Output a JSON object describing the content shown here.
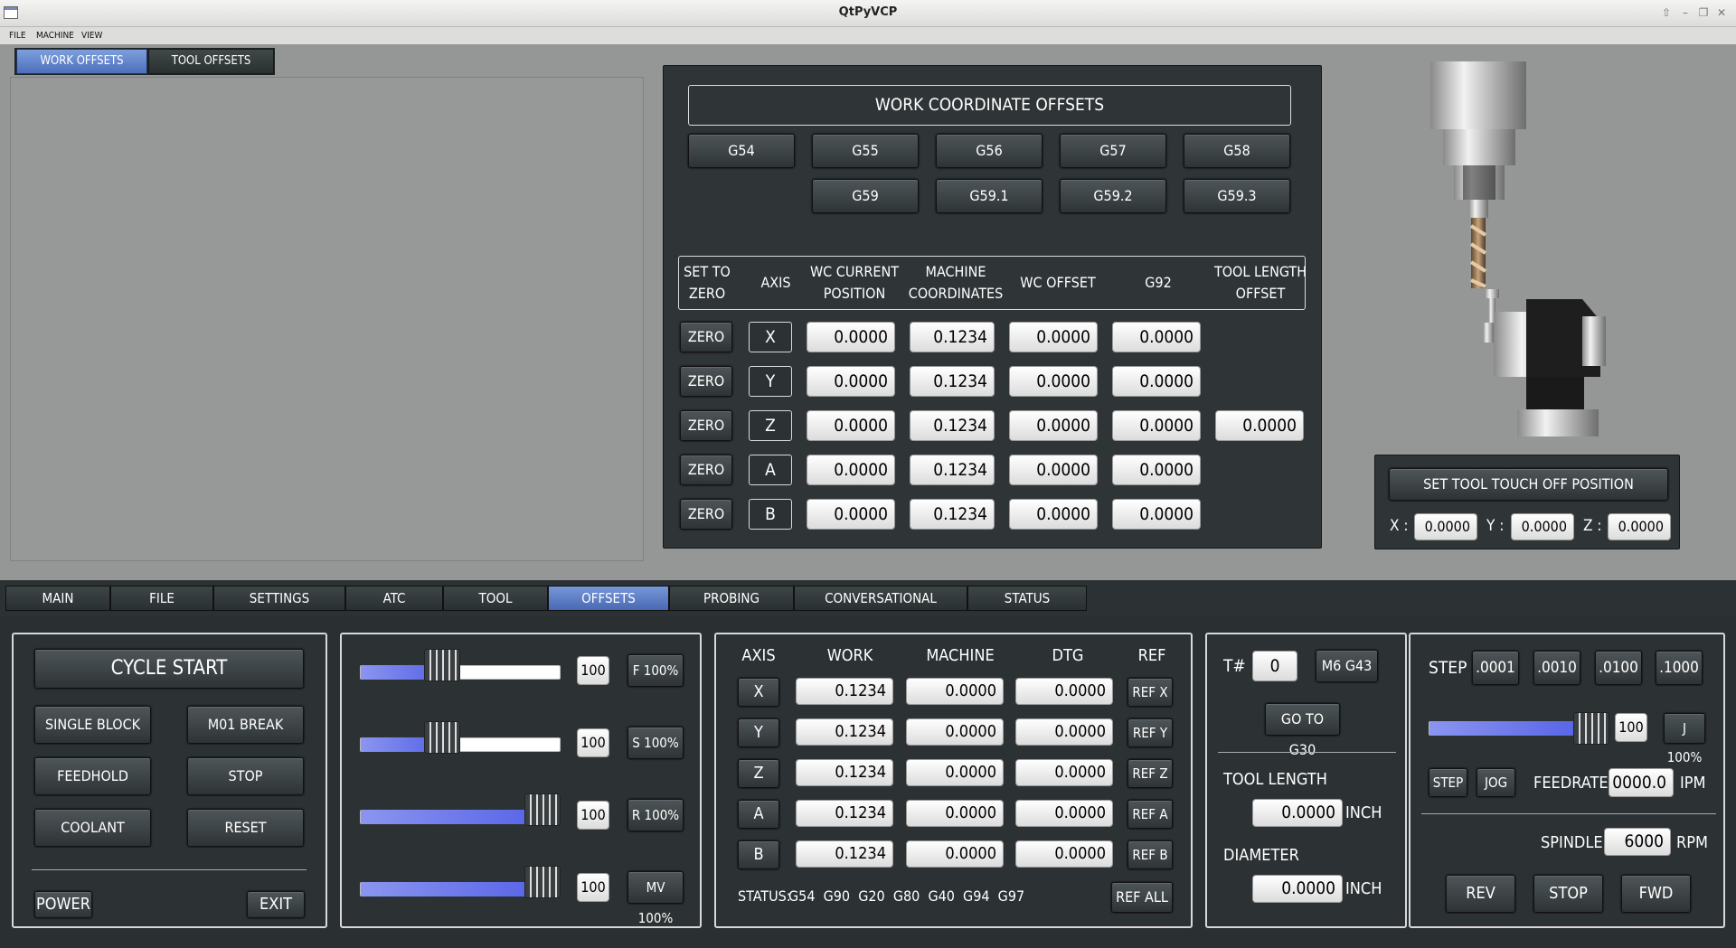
{
  "window": {
    "title": "QtPyVCP"
  },
  "menu": [
    "FILE",
    "MACHINE",
    "VIEW"
  ],
  "top_tabs": [
    {
      "label": "WORK OFFSETS",
      "active": true
    },
    {
      "label": "TOOL OFFSETS",
      "active": false
    }
  ],
  "wco": {
    "title": "WORK COORDINATE OFFSETS",
    "row1": [
      "G54",
      "G55",
      "G56",
      "G57",
      "G58"
    ],
    "row2": [
      "G59",
      "G59.1",
      "G59.2",
      "G59.3"
    ],
    "headers": [
      "SET TO ZERO",
      "AXIS",
      "WC CURRENT POSITION",
      "MACHINE COORDINATES",
      "WC OFFSET",
      "G92",
      "TOOL LENGTH OFFSET"
    ],
    "zero_label": "ZERO",
    "rows": [
      {
        "axis": "X",
        "wc": "0.0000",
        "mach": "0.1234",
        "off": "0.0000",
        "g92": "0.0000",
        "tlo": ""
      },
      {
        "axis": "Y",
        "wc": "0.0000",
        "mach": "0.1234",
        "off": "0.0000",
        "g92": "0.0000",
        "tlo": ""
      },
      {
        "axis": "Z",
        "wc": "0.0000",
        "mach": "0.1234",
        "off": "0.0000",
        "g92": "0.0000",
        "tlo": "0.0000"
      },
      {
        "axis": "A",
        "wc": "0.0000",
        "mach": "0.1234",
        "off": "0.0000",
        "g92": "0.0000",
        "tlo": ""
      },
      {
        "axis": "B",
        "wc": "0.0000",
        "mach": "0.1234",
        "off": "0.0000",
        "g92": "0.0000",
        "tlo": ""
      }
    ]
  },
  "touchoff": {
    "button": "SET TOOL TOUCH OFF POSITION",
    "x_label": "X :",
    "x": "0.0000",
    "y_label": "Y :",
    "y": "0.0000",
    "z_label": "Z :",
    "z": "0.0000"
  },
  "bottom_tabs": [
    {
      "label": "MAIN"
    },
    {
      "label": "FILE"
    },
    {
      "label": "SETTINGS"
    },
    {
      "label": "ATC"
    },
    {
      "label": "TOOL"
    },
    {
      "label": "OFFSETS",
      "active": true
    },
    {
      "label": "PROBING"
    },
    {
      "label": "CONVERSATIONAL"
    },
    {
      "label": "STATUS"
    }
  ],
  "control": {
    "cycle_start": "CYCLE START",
    "single_block": "SINGLE BLOCK",
    "m01_break": "M01 BREAK",
    "feedhold": "FEEDHOLD",
    "stop": "STOP",
    "coolant": "COOLANT",
    "reset": "RESET",
    "power": "POWER",
    "exit": "EXIT"
  },
  "overrides": [
    {
      "value": "100",
      "label": "F 100%",
      "fill": 0.5
    },
    {
      "value": "100",
      "label": "S 100%",
      "fill": 0.5
    },
    {
      "value": "100",
      "label": "R 100%",
      "fill": 1.0
    },
    {
      "value": "100",
      "label": "MV 100%",
      "fill": 1.0
    }
  ],
  "dro": {
    "headers": [
      "AXIS",
      "WORK",
      "MACHINE",
      "DTG",
      "REF"
    ],
    "rows": [
      {
        "axis": "X",
        "work": "0.1234",
        "mach": "0.0000",
        "dtg": "0.0000",
        "ref": "REF X"
      },
      {
        "axis": "Y",
        "work": "0.1234",
        "mach": "0.0000",
        "dtg": "0.0000",
        "ref": "REF Y"
      },
      {
        "axis": "Z",
        "work": "0.1234",
        "mach": "0.0000",
        "dtg": "0.0000",
        "ref": "REF Z"
      },
      {
        "axis": "A",
        "work": "0.1234",
        "mach": "0.0000",
        "dtg": "0.0000",
        "ref": "REF A"
      },
      {
        "axis": "B",
        "work": "0.1234",
        "mach": "0.0000",
        "dtg": "0.0000",
        "ref": "REF B"
      }
    ],
    "status_label": "STATUS:",
    "status": "G54  G90  G20  G80  G40  G94  G97",
    "ref_all": "REF ALL"
  },
  "tool": {
    "t_label": "T#",
    "t_value": "0",
    "m6g43": "M6 G43",
    "go_g30": "GO TO G30",
    "length_label": "TOOL LENGTH",
    "length": "0.0000",
    "length_unit": "INCH",
    "diameter_label": "DIAMETER",
    "diameter": "0.0000",
    "diameter_unit": "INCH"
  },
  "jog": {
    "step_label": "STEP",
    "steps": [
      ".0001",
      ".0010",
      ".0100",
      ".1000"
    ],
    "slider_value": "100",
    "j100": "J 100%",
    "slider_fill": 1.0,
    "step_btn": "STEP",
    "jog_btn": "JOG",
    "feedrate_label": "FEEDRATE",
    "feedrate": "0000.0",
    "feedrate_unit": "IPM",
    "spindle_label": "SPINDLE",
    "spindle": "6000",
    "spindle_unit": "RPM",
    "rev": "REV",
    "stop": "STOP",
    "fwd": "FWD"
  }
}
